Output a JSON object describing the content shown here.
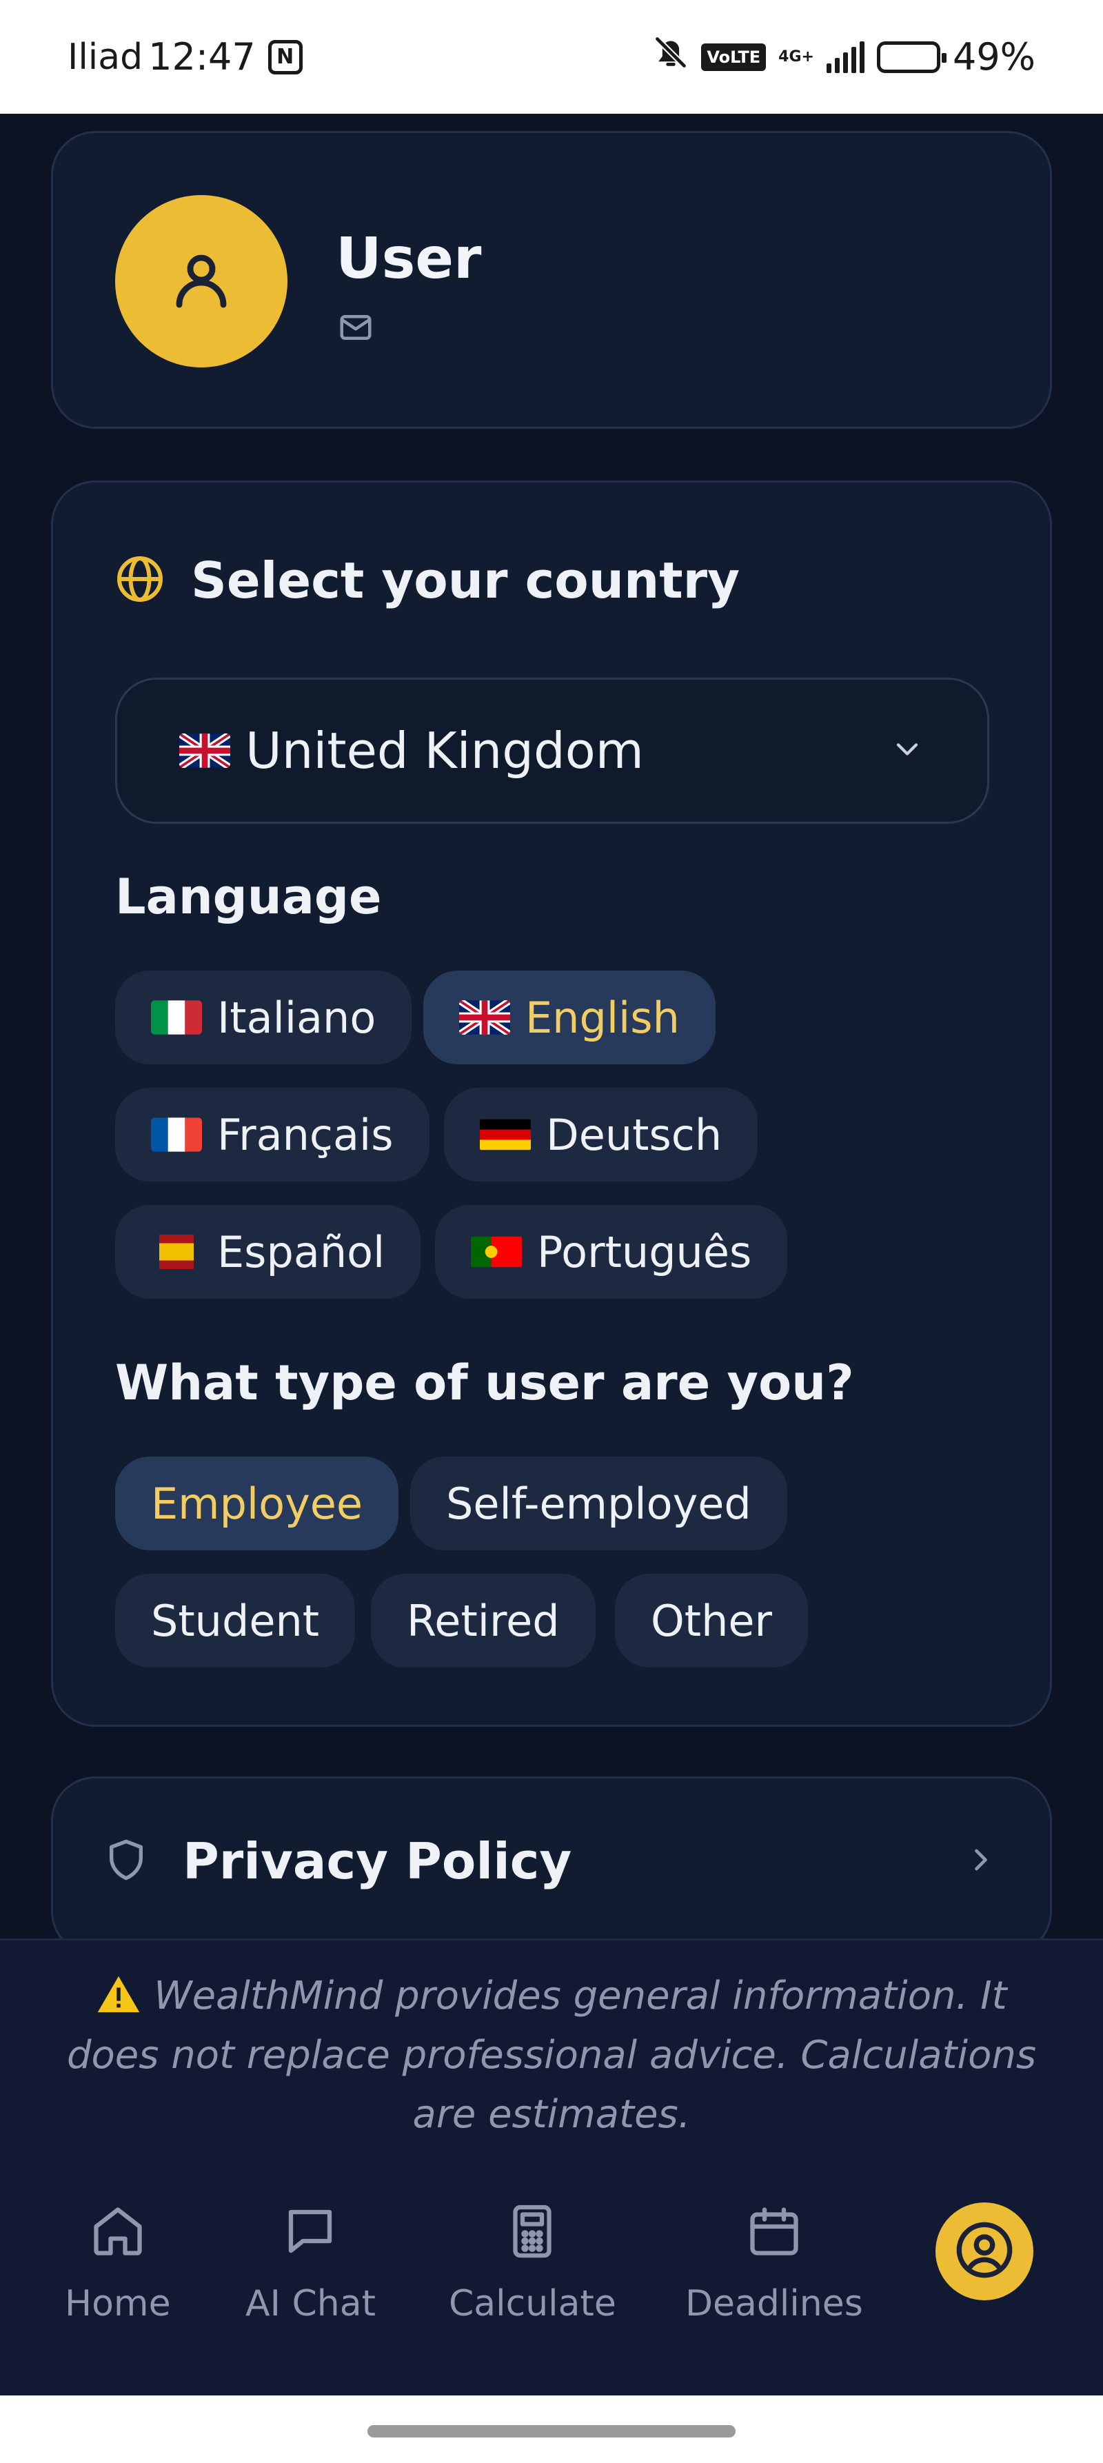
{
  "status_bar": {
    "carrier": "Iliad",
    "time": "12:47",
    "nfc": "N",
    "volte": "VoLTE",
    "network": "4G+",
    "battery_percent": "49%",
    "battery_level": 0.49
  },
  "profile": {
    "name": "User",
    "icons": [
      "user-icon",
      "mail-icon"
    ]
  },
  "settings": {
    "country_heading": "Select your country",
    "country_value": "United Kingdom",
    "language_label": "Language",
    "languages": [
      {
        "label": "Italiano",
        "flag": "it",
        "selected": false
      },
      {
        "label": "English",
        "flag": "gb",
        "selected": true
      },
      {
        "label": "Français",
        "flag": "fr",
        "selected": false
      },
      {
        "label": "Deutsch",
        "flag": "de",
        "selected": false
      },
      {
        "label": "Español",
        "flag": "es",
        "selected": false
      },
      {
        "label": "Português",
        "flag": "pt",
        "selected": false
      }
    ],
    "user_type_label": "What type of user are you?",
    "user_types": [
      {
        "label": "Employee",
        "selected": true
      },
      {
        "label": "Self-employed",
        "selected": false
      },
      {
        "label": "Student",
        "selected": false
      },
      {
        "label": "Retired",
        "selected": false
      },
      {
        "label": "Other",
        "selected": false
      }
    ]
  },
  "privacy": {
    "label": "Privacy Policy"
  },
  "disclaimer": {
    "text": "WealthMind provides general information. It does not replace professional advice. Calculations are estimates."
  },
  "nav": {
    "items": [
      {
        "label": "Home",
        "icon": "home-icon"
      },
      {
        "label": "AI Chat",
        "icon": "chat-icon"
      },
      {
        "label": "Calculate",
        "icon": "calculator-icon"
      },
      {
        "label": "Deadlines",
        "icon": "calendar-icon"
      }
    ],
    "active": "profile"
  },
  "colors": {
    "background": "#0b1324",
    "card": "#111c30",
    "accent": "#ecbd34",
    "selected_text": "#f2cd63",
    "muted": "#8e97ab"
  }
}
